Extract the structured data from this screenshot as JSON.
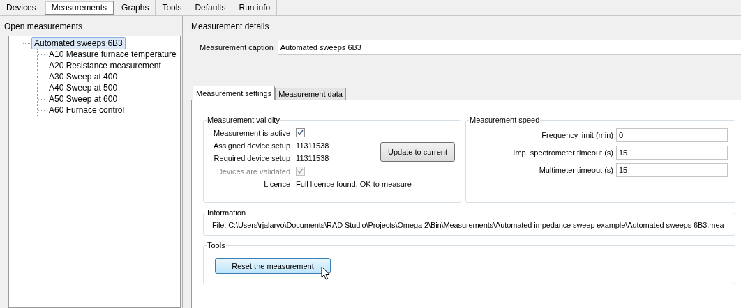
{
  "top_tabs": [
    {
      "label": "Devices",
      "selected": false
    },
    {
      "label": "Measurements",
      "selected": true
    },
    {
      "label": "Graphs",
      "selected": false
    },
    {
      "label": "Tools",
      "selected": false
    },
    {
      "label": "Defaults",
      "selected": false
    },
    {
      "label": "Run info",
      "selected": false
    }
  ],
  "open_measurements": {
    "title": "Open measurements",
    "tree": [
      {
        "label": "Automated sweeps 6B3",
        "selected": true,
        "children": [
          {
            "label": "A10 Measure furnace temperature",
            "selected": false
          },
          {
            "label": "A20 Resistance measurement",
            "selected": false
          },
          {
            "label": "A30 Sweep at 400",
            "selected": false
          },
          {
            "label": "A40 Sweep at 500",
            "selected": false
          },
          {
            "label": "A50 Sweep at 600",
            "selected": false
          },
          {
            "label": "A60 Furnace control",
            "selected": false
          }
        ]
      }
    ]
  },
  "details": {
    "title": "Measurement details",
    "caption": {
      "label": "Measurement caption",
      "value": "Automated sweeps 6B3"
    },
    "tabs": [
      {
        "label": "Measurement settings",
        "selected": true
      },
      {
        "label": "Measurement data",
        "selected": false
      }
    ],
    "validity": {
      "title": "Measurement validity",
      "rows": [
        {
          "kind": "checkbox",
          "label": "Measurement is active",
          "checked": true,
          "disabled": false
        },
        {
          "kind": "text",
          "label": "Assigned device setup",
          "value": "11311538"
        },
        {
          "kind": "text",
          "label": "Required device setup",
          "value": "11311538"
        },
        {
          "kind": "checkbox",
          "label": "Devices are validated",
          "checked": true,
          "disabled": true
        },
        {
          "kind": "text",
          "label": "Licence",
          "value": "Full licence found, OK to measure"
        }
      ],
      "button": "Update to current"
    },
    "speed": {
      "title": "Measurement speed",
      "fields": [
        {
          "label": "Frequency limit (min)",
          "value": "0"
        },
        {
          "label": "Imp. spectrometer timeout (s)",
          "value": "15"
        },
        {
          "label": "Multimeter timeout (s)",
          "value": "15"
        }
      ]
    },
    "information": {
      "title": "Information",
      "text": "File: C:\\Users\\rjalarvo\\Documents\\RAD Studio\\Projects\\Omega 2\\Bin\\Measurements\\Automated impedance sweep example\\Automated sweeps 6B3.mea"
    },
    "tools": {
      "title": "Tools",
      "button": "Reset the measurement",
      "hovered": true
    }
  }
}
